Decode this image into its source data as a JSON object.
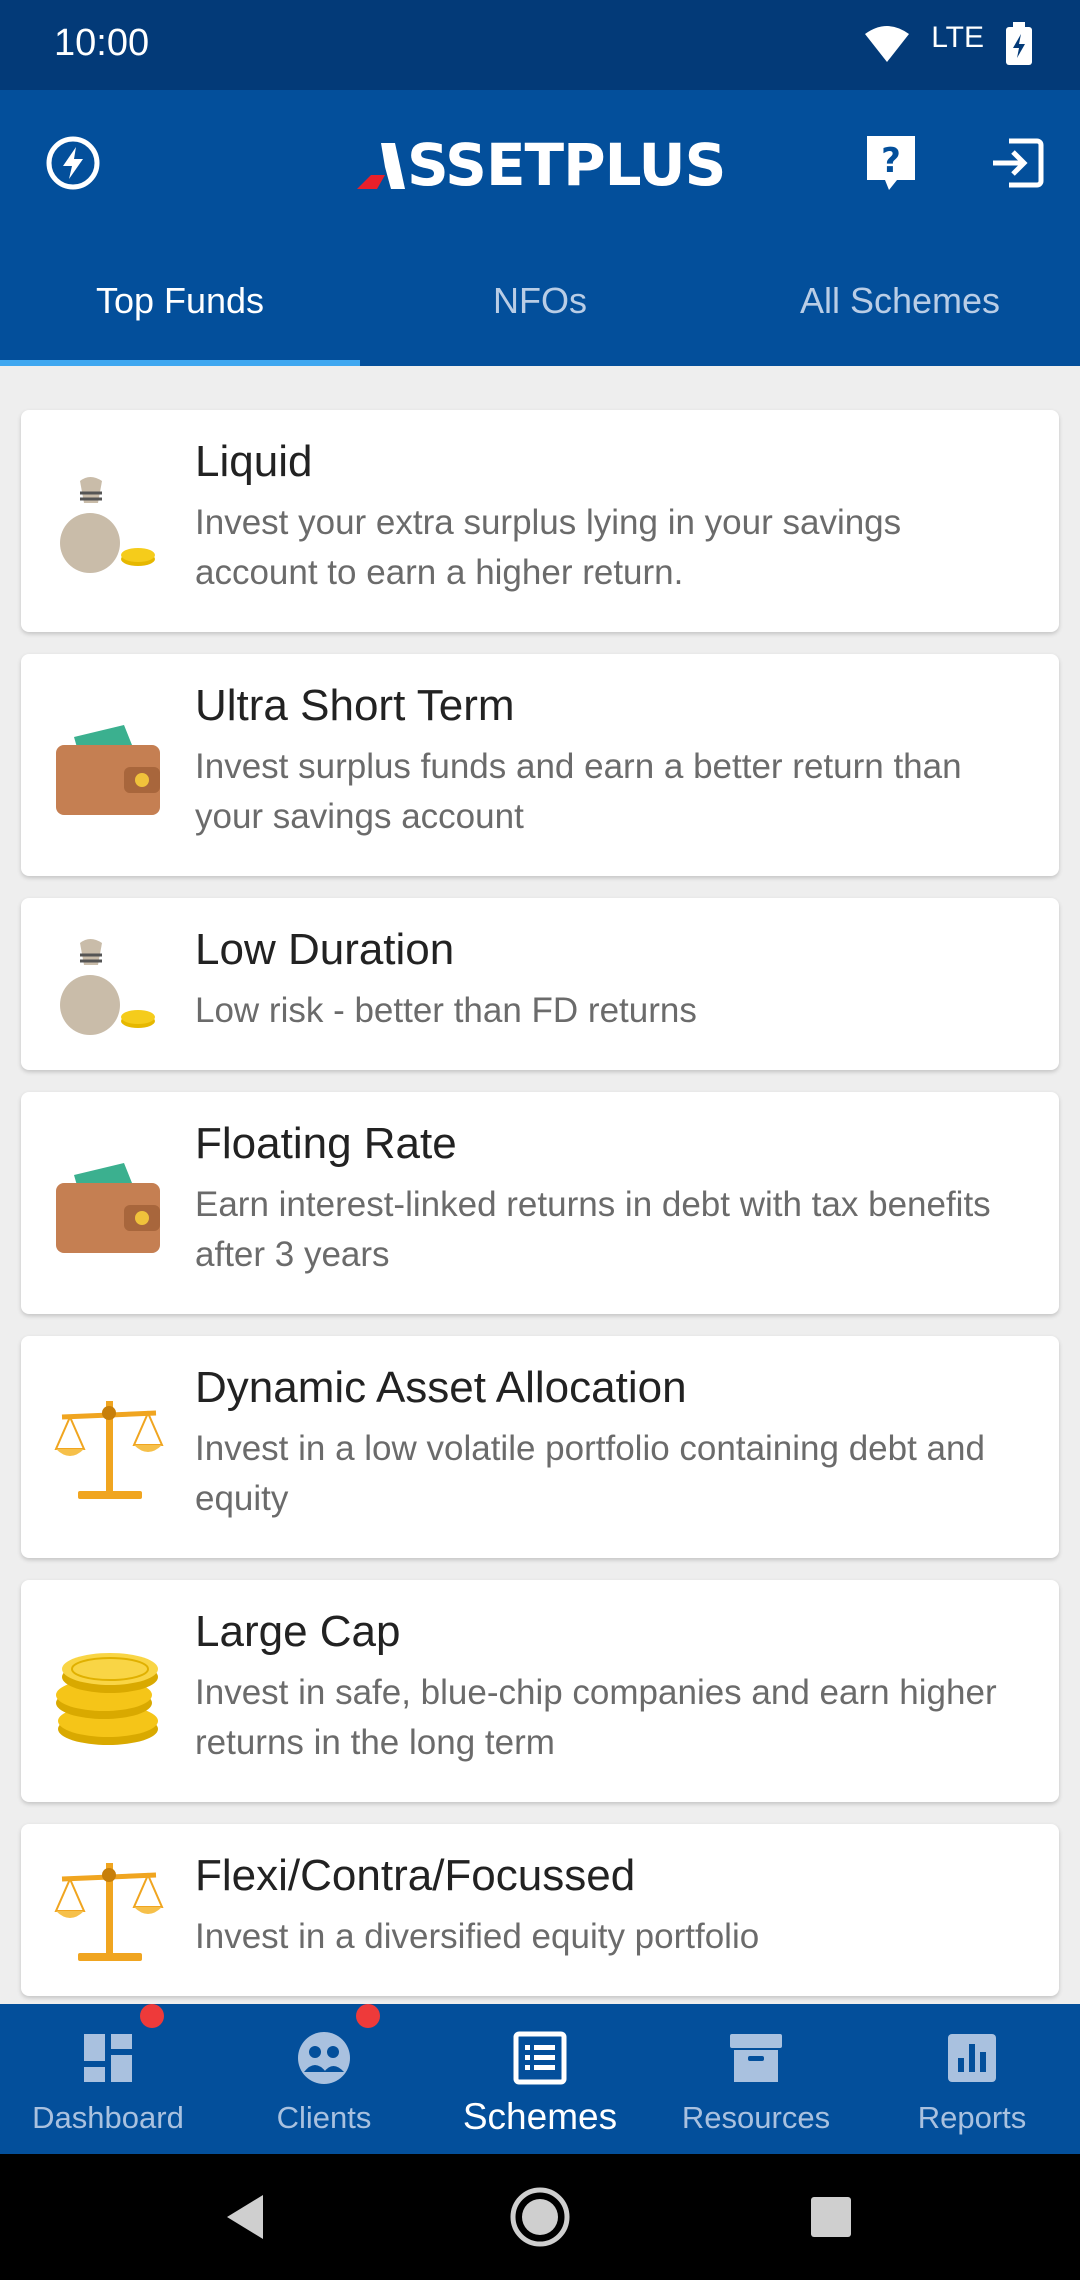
{
  "status_bar": {
    "time": "10:00",
    "network": "LTE"
  },
  "app": {
    "logo_text": "SSETPLUS",
    "logo_full": "ASSETPLUS"
  },
  "tabs": [
    {
      "label": "Top Funds",
      "active": true
    },
    {
      "label": "NFOs",
      "active": false
    },
    {
      "label": "All Schemes",
      "active": false
    }
  ],
  "funds": [
    {
      "title": "Liquid",
      "description": "Invest your extra surplus lying in your savings account to earn a higher return.",
      "icon": "money-bag-icon"
    },
    {
      "title": "Ultra Short Term",
      "description": "Invest surplus funds and earn a better return than your savings account",
      "icon": "wallet-icon"
    },
    {
      "title": "Low Duration",
      "description": "Low risk - better than FD returns",
      "icon": "money-bag-icon"
    },
    {
      "title": "Floating Rate",
      "description": "Earn interest-linked returns in debt with tax benefits after 3 years",
      "icon": "wallet-icon"
    },
    {
      "title": "Dynamic Asset Allocation",
      "description": "Invest in a low volatile portfolio containing debt and equity",
      "icon": "balance-scale-icon"
    },
    {
      "title": "Large Cap",
      "description": "Invest in safe, blue-chip companies and earn higher returns in the long term",
      "icon": "coins-stack-icon"
    },
    {
      "title": "Flexi/Contra/Focussed",
      "description": "Invest in a diversified equity portfolio",
      "icon": "balance-scale-icon"
    }
  ],
  "bottom_nav": [
    {
      "label": "Dashboard",
      "icon": "dashboard-icon",
      "badge": true,
      "active": false
    },
    {
      "label": "Clients",
      "icon": "clients-icon",
      "badge": true,
      "active": false
    },
    {
      "label": "Schemes",
      "icon": "schemes-icon",
      "badge": false,
      "active": true
    },
    {
      "label": "Resources",
      "icon": "resources-icon",
      "badge": false,
      "active": false
    },
    {
      "label": "Reports",
      "icon": "reports-icon",
      "badge": false,
      "active": false
    }
  ],
  "colors": {
    "primary": "#034f9b",
    "status_bar": "#033a78",
    "tab_indicator": "#3fa7f0",
    "badge": "#ee3a3a",
    "logo_accent": "#e8202a"
  }
}
